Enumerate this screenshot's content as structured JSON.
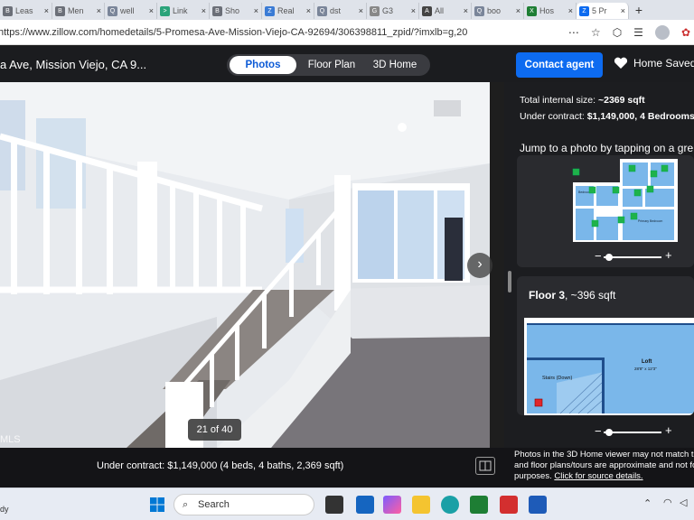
{
  "tabs": [
    {
      "label": "Leas",
      "color": "#6b6f78",
      "glyph": "B"
    },
    {
      "label": "Men",
      "color": "#6b6f78",
      "glyph": "B"
    },
    {
      "label": "well",
      "color": "#7a8599",
      "glyph": "Q"
    },
    {
      "label": "Link",
      "color": "#2aa37a",
      "glyph": ">"
    },
    {
      "label": "Sho",
      "color": "#6b6f78",
      "glyph": "B"
    },
    {
      "label": "Real",
      "color": "#3a7bd5",
      "glyph": "Z"
    },
    {
      "label": "dst",
      "color": "#7a8599",
      "glyph": "Q"
    },
    {
      "label": "G3",
      "color": "#888",
      "glyph": "G"
    },
    {
      "label": "All",
      "color": "#444",
      "glyph": "A"
    },
    {
      "label": "boo",
      "color": "#7a8599",
      "glyph": "Q"
    },
    {
      "label": "Hos",
      "color": "#1e7e34",
      "glyph": "X"
    },
    {
      "label": "5 Pr",
      "color": "#0d6bf0",
      "glyph": "Z"
    }
  ],
  "browser": {
    "url": "https://www.zillow.com/homedetails/5-Promesa-Ave-Mission-Viejo-CA-92694/306398811_zpid/?imxlb=g,20"
  },
  "header": {
    "address": "a Ave, Mission Viejo, CA 9...",
    "photos_tab": "Photos",
    "floorplan_tab": "Floor Plan",
    "home3d_tab": "3D Home",
    "contact_button": "Contact agent",
    "saved_label": "Home Saved"
  },
  "photo": {
    "counter": "21 of 40",
    "watermark": "MLS"
  },
  "sidebar": {
    "internal_size_label": "Total internal size:",
    "internal_size_value": "~2369 sqft",
    "contract_label": "Under contract:",
    "contract_value": "$1,149,000, 4",
    "bedrooms_word": "Bedrooms",
    "jump_text": "Jump to a photo by tapping on a gre",
    "floor3_title": "Floor 3",
    "floor3_size": ", ~396 sqft",
    "room_labels": {
      "bedroom": "Bedroom",
      "primary_bedroom": "Primary Bedroom",
      "loft": "Loft",
      "loft_dims": "28'8\" x 12'3\"",
      "stairs": "Stairs (Down)"
    }
  },
  "bottom": {
    "contract_summary": "Under contract: $1,149,000 (4 beds, 4 baths, 2,369 sqft)",
    "disclaimer_line1": "Photos in the 3D Home viewer may not match th",
    "disclaimer_line2": "and floor plans/tours are approximate and not fo",
    "disclaimer_line3": "purposes.",
    "source_link": "Click for source details."
  },
  "taskbar": {
    "status_left": "dy",
    "search_placeholder": "Search"
  },
  "colors": {
    "accent": "#0d6bf0",
    "dark_bg": "#1b1c1f",
    "hotspot": "#1fb24a",
    "selected_hotspot": "#e0262a"
  }
}
